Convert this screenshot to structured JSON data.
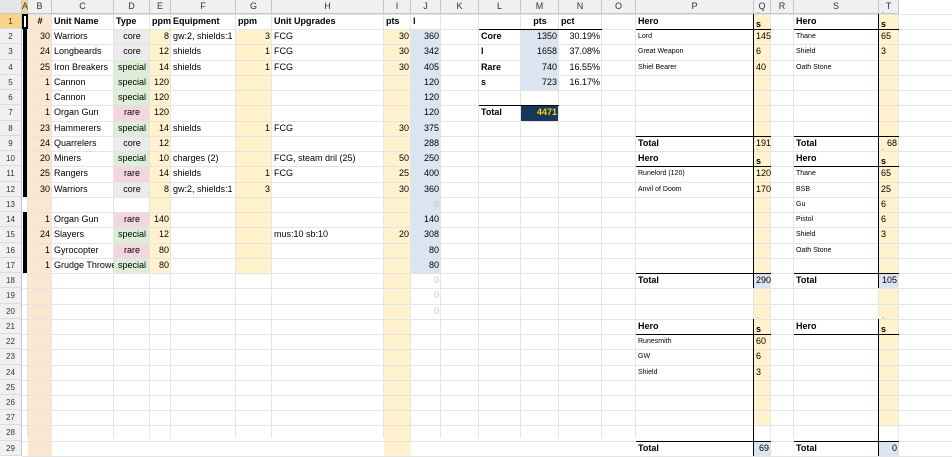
{
  "columns": [
    "A",
    "B",
    "C",
    "D",
    "E",
    "F",
    "G",
    "H",
    "I",
    "J",
    "K",
    "L",
    "M",
    "N",
    "O",
    "P",
    "Q",
    "R",
    "S",
    "T"
  ],
  "rows": [
    "1",
    "2",
    "3",
    "4",
    "5",
    "6",
    "7",
    "8",
    "9",
    "10",
    "11",
    "12",
    "13",
    "14",
    "15",
    "16",
    "17",
    "18",
    "19",
    "20",
    "21",
    "22",
    "23",
    "24",
    "25",
    "26",
    "27",
    "28",
    "29"
  ],
  "selected_cell": "A1",
  "army_table": {
    "headers": {
      "count": "#",
      "name": "Unit Name",
      "type": "Type",
      "ppm": "ppm",
      "equipment": "Equipment",
      "ppm2": "ppm",
      "upgrades": "Unit Upgrades",
      "pts": "pts",
      "total": "l"
    },
    "rows": [
      {
        "r": 2,
        "count": "30",
        "name": "Warriors",
        "type": "core",
        "ppm": "8",
        "equipment": "gw:2, shields:1",
        "ppm2": "3",
        "upgrades": "FCG",
        "pts": "30",
        "total": "360"
      },
      {
        "r": 3,
        "count": "24",
        "name": "Longbeards",
        "type": "core",
        "ppm": "12",
        "equipment": "shields",
        "ppm2": "1",
        "upgrades": "FCG",
        "pts": "30",
        "total": "342"
      },
      {
        "r": 4,
        "count": "25",
        "name": "Iron Breakers",
        "type": "special",
        "ppm": "14",
        "equipment": "shields",
        "ppm2": "1",
        "upgrades": "FCG",
        "pts": "30",
        "total": "405"
      },
      {
        "r": 5,
        "count": "1",
        "name": "Cannon",
        "type": "special",
        "ppm": "120",
        "equipment": "",
        "ppm2": "",
        "upgrades": "",
        "pts": "",
        "total": "120"
      },
      {
        "r": 6,
        "count": "1",
        "name": "Cannon",
        "type": "special",
        "ppm": "120",
        "equipment": "",
        "ppm2": "",
        "upgrades": "",
        "pts": "",
        "total": "120"
      },
      {
        "r": 7,
        "count": "1",
        "name": "Organ Gun",
        "type": "rare",
        "ppm": "120",
        "equipment": "",
        "ppm2": "",
        "upgrades": "",
        "pts": "",
        "total": "120"
      },
      {
        "r": 8,
        "count": "23",
        "name": "Hammerers",
        "type": "special",
        "ppm": "14",
        "equipment": "shields",
        "ppm2": "1",
        "upgrades": "FCG",
        "pts": "30",
        "total": "375"
      },
      {
        "r": 9,
        "count": "24",
        "name": "Quarrelers",
        "type": "core",
        "ppm": "12",
        "equipment": "",
        "ppm2": "",
        "upgrades": "",
        "pts": "",
        "total": "288"
      },
      {
        "r": 10,
        "count": "20",
        "name": "Miners",
        "type": "special",
        "ppm": "10",
        "equipment": "charges (2)",
        "ppm2": "",
        "upgrades": "FCG, steam dril (25)",
        "pts": "50",
        "total": "250"
      },
      {
        "r": 11,
        "count": "25",
        "name": "Rangers",
        "type": "rare",
        "ppm": "14",
        "equipment": "shields",
        "ppm2": "1",
        "upgrades": "FCG",
        "pts": "25",
        "total": "400"
      },
      {
        "r": 12,
        "count": "30",
        "name": "Warriors",
        "type": "core",
        "ppm": "8",
        "equipment": "gw:2, shields:1",
        "ppm2": "3",
        "upgrades": "",
        "pts": "30",
        "total": "360"
      },
      {
        "r": 13,
        "count": "",
        "name": "",
        "type": "",
        "ppm": "",
        "equipment": "",
        "ppm2": "",
        "upgrades": "",
        "pts": "",
        "total": "0"
      },
      {
        "r": 14,
        "count": "1",
        "name": "Organ Gun",
        "type": "rare",
        "ppm": "140",
        "equipment": "",
        "ppm2": "",
        "upgrades": "",
        "pts": "",
        "total": "140"
      },
      {
        "r": 15,
        "count": "24",
        "name": "Slayers",
        "type": "special",
        "ppm": "12",
        "equipment": "",
        "ppm2": "",
        "upgrades": "mus:10 sb:10",
        "pts": "20",
        "total": "308"
      },
      {
        "r": 16,
        "count": "1",
        "name": "Gyrocopter",
        "type": "rare",
        "ppm": "80",
        "equipment": "",
        "ppm2": "",
        "upgrades": "",
        "pts": "",
        "total": "80"
      },
      {
        "r": 17,
        "count": "1",
        "name": "Grudge Thrower",
        "type": "special",
        "ppm": "80",
        "equipment": "",
        "ppm2": "",
        "upgrades": "",
        "pts": "",
        "total": "80"
      },
      {
        "r": 18,
        "count": "",
        "name": "",
        "type": "",
        "ppm": "",
        "equipment": "",
        "ppm2": "",
        "upgrades": "",
        "pts": "",
        "total": "0"
      },
      {
        "r": 19,
        "count": "",
        "name": "",
        "type": "",
        "ppm": "",
        "equipment": "",
        "ppm2": "",
        "upgrades": "",
        "pts": "",
        "total": "0"
      },
      {
        "r": 20,
        "count": "",
        "name": "",
        "type": "",
        "ppm": "",
        "equipment": "",
        "ppm2": "",
        "upgrades": "",
        "pts": "",
        "total": "0"
      }
    ]
  },
  "summary": {
    "headers": {
      "pts": "pts",
      "pct": "pct"
    },
    "rows": [
      {
        "label": "Core",
        "pts": "1350",
        "pct": "30.19%"
      },
      {
        "label": "l",
        "pts": "1658",
        "pct": "37.08%"
      },
      {
        "label": "Rare",
        "pts": "740",
        "pct": "16.55%"
      },
      {
        "label": "s",
        "pts": "723",
        "pct": "16.17%"
      }
    ],
    "total_label": "Total",
    "total_value": "4471"
  },
  "hero_boxes": [
    {
      "title": "Hero",
      "col_header": "s",
      "items": [
        {
          "name": "Lord",
          "value": "145"
        },
        {
          "name": "Great Weapon",
          "value": "6"
        },
        {
          "name": "Shiel Bearer",
          "value": "40"
        }
      ],
      "total_label": "Total",
      "total": "191"
    },
    {
      "title": "Hero",
      "col_header": "s",
      "items": [
        {
          "name": "Thane",
          "value": "65"
        },
        {
          "name": "Shield",
          "value": "3"
        },
        {
          "name": "Oath Stone",
          "value": ""
        }
      ],
      "total_label": "Total",
      "total": "68"
    },
    {
      "title": "Hero",
      "col_header": "s",
      "items": [
        {
          "name": "Runelord (120)",
          "value": "120"
        },
        {
          "name": "Anvil of Doom",
          "value": "170"
        }
      ],
      "total_label": "Total",
      "total": "290"
    },
    {
      "title": "Hero",
      "col_header": "s",
      "items": [
        {
          "name": "Thane",
          "value": "65"
        },
        {
          "name": "BSB",
          "value": "25"
        },
        {
          "name": "Gu",
          "value": "6"
        },
        {
          "name": "Pistol",
          "value": "6"
        },
        {
          "name": "Shield",
          "value": "3"
        },
        {
          "name": "Oath Stone",
          "value": ""
        }
      ],
      "total_label": "Total",
      "total": "105"
    },
    {
      "title": "Hero",
      "col_header": "s",
      "items": [
        {
          "name": "Runesmith",
          "value": "60"
        },
        {
          "name": "GW",
          "value": "6"
        },
        {
          "name": "Shield",
          "value": "3"
        }
      ],
      "total_label": "Total",
      "total": "69"
    },
    {
      "title": "Hero",
      "col_header": "s",
      "items": [],
      "total_label": "Total",
      "total": "0"
    }
  ],
  "colors": {
    "peach": "#fbe6cf",
    "yellow": "#fff2cc",
    "blue": "#dbe5f1",
    "green": "#dcefd6",
    "pink": "#f2d7de",
    "grey": "#ececec",
    "navy": "#17375e",
    "gold": "#ffd700"
  }
}
